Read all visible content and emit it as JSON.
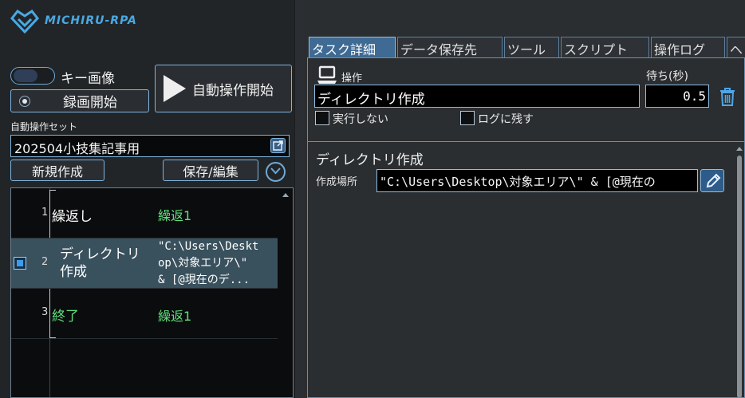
{
  "app": {
    "name": "MICHIRU-RPA",
    "logo_icon": "heart-diamond-logo",
    "accent_color": "#49a9e3"
  },
  "controls": {
    "key_image_label": "キー画像",
    "key_image_enabled": false,
    "record_label": "録画開始",
    "auto_start_label": "自動操作開始"
  },
  "operation_set": {
    "label": "自動操作セット",
    "value": "202504小技集記事用",
    "new_label": "新規作成",
    "save_edit_label": "保存/編集"
  },
  "tasks": [
    {
      "num": "1",
      "name": "繰返し",
      "detail": "繰返1"
    },
    {
      "num": "2",
      "name_line1": "ディレクトリ",
      "name_line2": "作成",
      "detail_line1": "\"C:\\Users\\Deskt",
      "detail_line2": "op\\対象エリア\\\"",
      "detail_line3": "& [@現在のデ...",
      "selected": true
    },
    {
      "num": "3",
      "name": "終了",
      "detail": "繰返1"
    }
  ],
  "tabs": [
    "タスク詳細",
    "データ保存先",
    "ツール",
    "スクリプト",
    "操作ログ",
    "ヘ"
  ],
  "active_tab": 0,
  "task_detail": {
    "operation_label": "操作",
    "operation_value": "ディレクトリ作成",
    "wait_label": "待ち(秒)",
    "wait_value": "0.5",
    "no_execute_label": "実行しない",
    "no_execute_checked": false,
    "keep_log_label": "ログに残す",
    "keep_log_checked": false,
    "section_title": "ディレクトリ作成",
    "path_label": "作成場所",
    "path_value": "\"C:\\Users\\Desktop\\対象エリア\\\" & [@現在の"
  }
}
